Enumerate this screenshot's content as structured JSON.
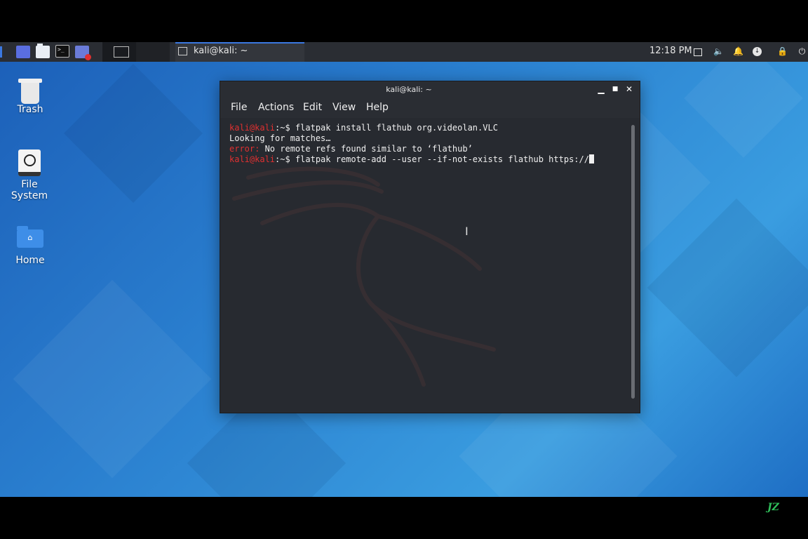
{
  "panel": {
    "task_title": "kali@kali: ~",
    "clock": "12:18 PM"
  },
  "desktop_icons": [
    {
      "label": "Trash"
    },
    {
      "label": "File System"
    },
    {
      "label": "Home"
    }
  ],
  "window": {
    "title": "kali@kali: ~",
    "minimize": "▁",
    "maximize": "■",
    "close": "✕",
    "menu": [
      "File",
      "Actions",
      "Edit",
      "View",
      "Help"
    ]
  },
  "terminal": {
    "prompt_user": "kali@kali",
    "prompt_tail": ":~$ ",
    "lines": [
      {
        "cmd": "flatpak install flathub org.videolan.VLC"
      },
      {
        "text": "Looking for matches…"
      },
      {
        "error_label": "error:",
        "text": " No remote refs found similar to ‘flathub’"
      },
      {
        "cmd": "flatpak remote-add --user --if-not-exists flathub https://"
      }
    ]
  },
  "colors": {
    "prompt": "#e03030",
    "panel": "#2a2d33",
    "accent": "#3b78e0"
  },
  "icons": [
    "trash-icon",
    "file-system-icon",
    "home-folder-icon",
    "terminal-icon",
    "notification-icon",
    "volume-icon",
    "lock-icon",
    "power-icon"
  ]
}
